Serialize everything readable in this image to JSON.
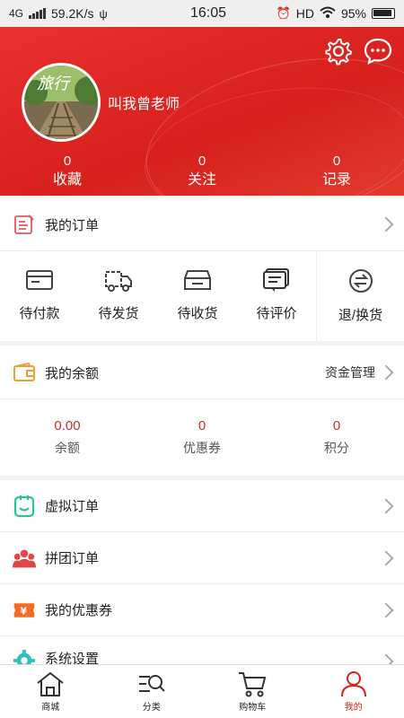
{
  "status_bar": {
    "network": "4G",
    "speed": "59.2K/s",
    "time": "16:05",
    "hd": "HD",
    "battery": "95%"
  },
  "profile": {
    "username": "叫我曾老师",
    "avatar_text": "旅行"
  },
  "stats": [
    {
      "value": "0",
      "label": "收藏"
    },
    {
      "value": "0",
      "label": "关注"
    },
    {
      "value": "0",
      "label": "记录"
    }
  ],
  "orders": {
    "title": "我的订单",
    "items": [
      {
        "label": "待付款",
        "icon": "wallet-card-icon"
      },
      {
        "label": "待发货",
        "icon": "truck-icon"
      },
      {
        "label": "待收货",
        "icon": "box-icon"
      },
      {
        "label": "待评价",
        "icon": "comment-icon"
      },
      {
        "label": "退/换货",
        "icon": "exchange-icon"
      }
    ]
  },
  "balance_section": {
    "title": "我的余额",
    "manage": "资金管理",
    "items": [
      {
        "value": "0.00",
        "label": "余额"
      },
      {
        "value": "0",
        "label": "优惠券"
      },
      {
        "value": "0",
        "label": "积分"
      }
    ]
  },
  "menu": [
    {
      "label": "虚拟订单",
      "icon": "virtual-order-icon"
    },
    {
      "label": "拼团订单",
      "icon": "group-order-icon"
    },
    {
      "label": "我的优惠券",
      "icon": "coupon-icon"
    },
    {
      "label": "系统设置",
      "icon": "settings-gear-icon"
    }
  ],
  "tabs": [
    {
      "label": "商城",
      "icon": "home-icon"
    },
    {
      "label": "分类",
      "icon": "category-search-icon"
    },
    {
      "label": "购物车",
      "icon": "cart-icon"
    },
    {
      "label": "我的",
      "icon": "user-icon"
    }
  ],
  "colors": {
    "brand_red": "#d7201c",
    "price_red": "#c9302c"
  }
}
